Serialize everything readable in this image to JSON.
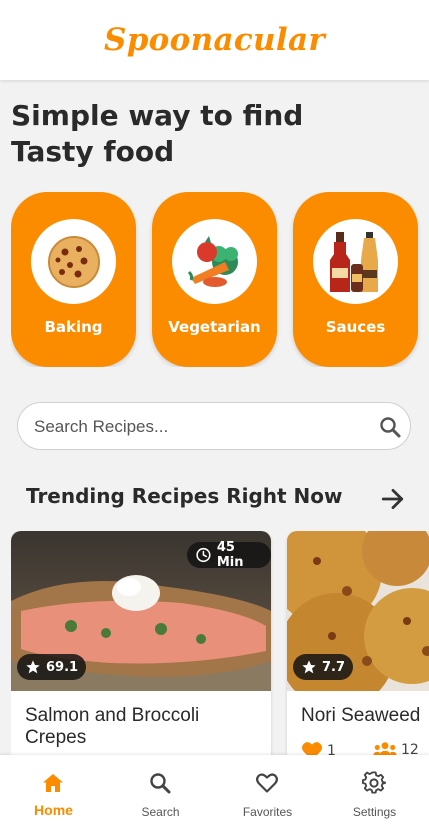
{
  "app": {
    "logo": "Spoonacular"
  },
  "headline": {
    "line1": "Simple way to find",
    "line2": "Tasty food"
  },
  "categories": [
    {
      "label": "Baking",
      "icon": "cookie-icon"
    },
    {
      "label": "Vegetarian",
      "icon": "vegetables-icon"
    },
    {
      "label": "Sauces",
      "icon": "sauce-bottles-icon"
    }
  ],
  "search": {
    "placeholder": "Search Recipes...",
    "value": "",
    "icon": "search-icon"
  },
  "trending": {
    "title": "Trending Recipes Right Now",
    "icon": "arrow-right-icon"
  },
  "recipes": [
    {
      "title": "Salmon and Broccoli Crepes",
      "time": "45 Min",
      "rating": "69.1",
      "likes": "",
      "servings": ""
    },
    {
      "title": "Nori Seaweed",
      "time": "",
      "rating": "7.7",
      "likes": "1",
      "servings": "12"
    }
  ],
  "nav": [
    {
      "label": "Home",
      "icon": "home-icon",
      "active": true
    },
    {
      "label": "Search",
      "icon": "search-icon",
      "active": false
    },
    {
      "label": "Favorites",
      "icon": "heart-icon",
      "active": false
    },
    {
      "label": "Settings",
      "icon": "gear-icon",
      "active": false
    }
  ],
  "colors": {
    "accent": "#fb8c00",
    "background": "#f2f2f2",
    "card": "#ffffff",
    "text": "#2a2a2a"
  }
}
